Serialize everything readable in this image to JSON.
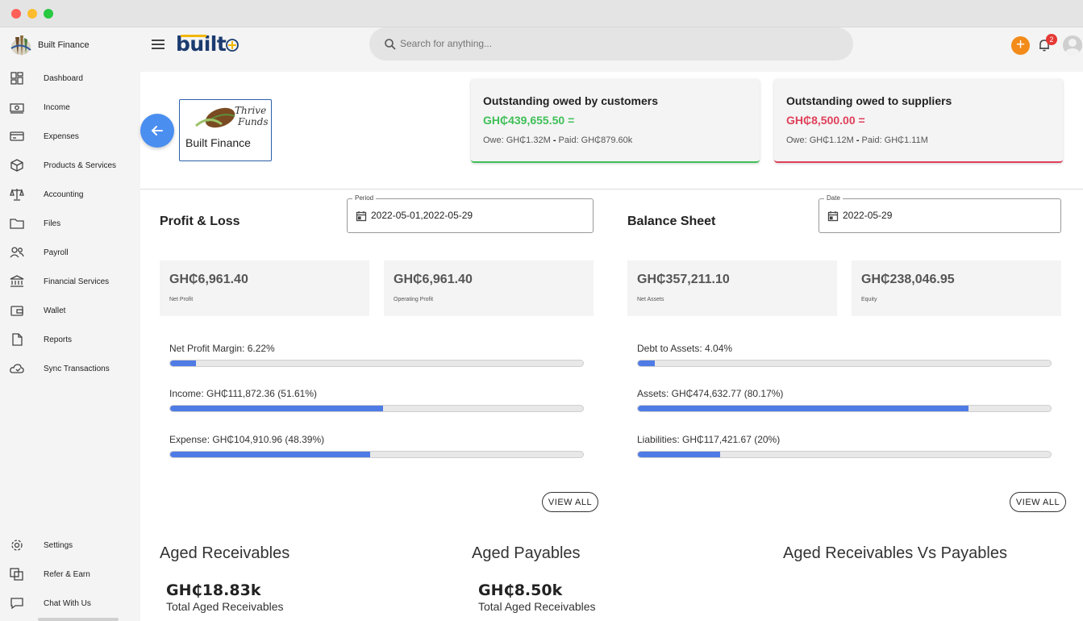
{
  "sidebar": {
    "brand_name": "Built Finance",
    "items": [
      {
        "label": "Dashboard",
        "icon": "dashboard-icon"
      },
      {
        "label": "Income",
        "icon": "money-icon"
      },
      {
        "label": "Expenses",
        "icon": "expense-icon"
      },
      {
        "label": "Products & Services",
        "icon": "box-icon"
      },
      {
        "label": "Accounting",
        "icon": "scale-icon"
      },
      {
        "label": "Files",
        "icon": "folder-icon"
      },
      {
        "label": "Payroll",
        "icon": "people-icon"
      },
      {
        "label": "Financial Services",
        "icon": "bank-icon"
      },
      {
        "label": "Wallet",
        "icon": "wallet-icon"
      },
      {
        "label": "Reports",
        "icon": "document-icon"
      },
      {
        "label": "Sync Transactions",
        "icon": "cloud-sync-icon"
      }
    ],
    "bottom_items": [
      {
        "label": "Settings",
        "icon": "gear-icon"
      },
      {
        "label": "Refer & Earn",
        "icon": "refer-icon"
      },
      {
        "label": "Chat With Us",
        "icon": "chat-icon"
      }
    ]
  },
  "topbar": {
    "logo_text": "built",
    "search_placeholder": "Search for anything...",
    "add_label": "+",
    "notification_count": "2"
  },
  "company": {
    "logo_line1": "Thrive",
    "logo_line2": "Funds",
    "name": "Built Finance"
  },
  "outstanding": {
    "customers": {
      "title": "Outstanding owed by customers",
      "amount": "GH₵439,655.50 =",
      "owe": "Owe: GH₵1.32M",
      "paid": "Paid: GH₵879.60k",
      "color": "#3fbf57"
    },
    "suppliers": {
      "title": "Outstanding owed to suppliers",
      "amount": "GH₵8,500.00 =",
      "owe": "Owe: GH₵1.12M",
      "paid": "Paid: GH₵1.11M",
      "color": "#e0405a"
    },
    "separator": "-"
  },
  "profit_loss": {
    "title": "Profit & Loss",
    "period_label": "Period",
    "period_value": "2022-05-01,2022-05-29",
    "stats": [
      {
        "value": "GH₵6,961.40",
        "label": "Net Profit"
      },
      {
        "value": "GH₵6,961.40",
        "label": "Operating Profit"
      }
    ],
    "bars": [
      {
        "label": "Net Profit Margin: 6.22%",
        "fraction": 0.0622
      },
      {
        "label": "Income: GH₵111,872.36 (51.61%)",
        "fraction": 0.5161
      },
      {
        "label": "Expense: GH₵104,910.96 (48.39%)",
        "fraction": 0.4839
      }
    ],
    "view_all": "VIEW ALL"
  },
  "balance_sheet": {
    "title": "Balance Sheet",
    "date_label": "Date",
    "date_value": "2022-05-29",
    "stats": [
      {
        "value": "GH₵357,211.10",
        "label": "Net Assets"
      },
      {
        "value": "GH₵238,046.95",
        "label": "Equity"
      }
    ],
    "bars": [
      {
        "label": "Debt to Assets: 4.04%",
        "fraction": 0.0404
      },
      {
        "label": "Assets: GH₵474,632.77 (80.17%)",
        "fraction": 0.8017
      },
      {
        "label": "Liabilities: GH₵117,421.67 (20%)",
        "fraction": 0.2
      }
    ],
    "view_all": "VIEW ALL"
  },
  "aged": {
    "receivables": {
      "title": "Aged Receivables",
      "amount": "GH₵18.83k",
      "subtitle": "Total Aged Receivables"
    },
    "payables": {
      "title": "Aged Payables",
      "amount": "GH₵8.50k",
      "subtitle": "Total Aged Receivables"
    },
    "vs": {
      "title": "Aged Receivables Vs Payables"
    }
  },
  "colors": {
    "accent": "#4a8ef0",
    "bar_fill": "#4f7be6",
    "add_button": "#f28b1a",
    "badge": "#e53935"
  }
}
